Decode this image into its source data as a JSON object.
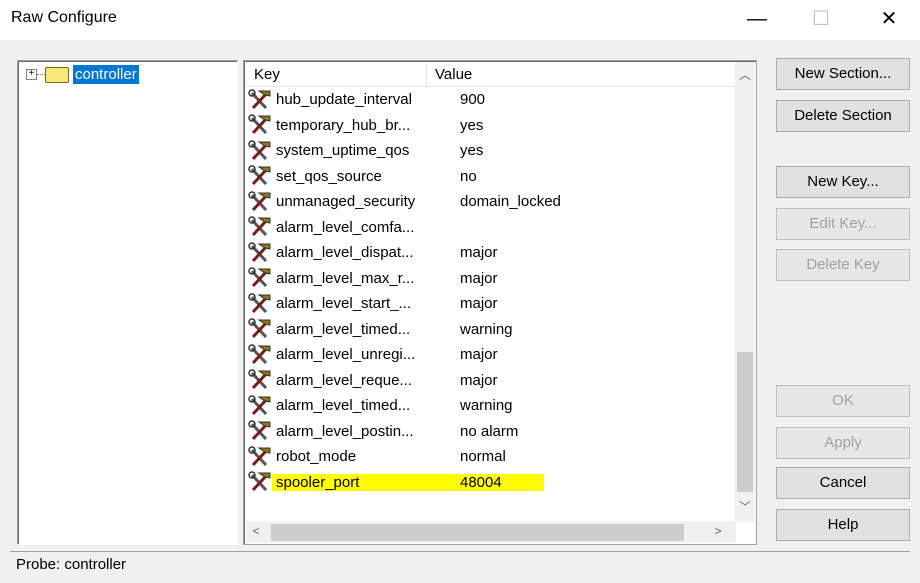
{
  "window": {
    "title": "Raw Configure",
    "minimize": "—",
    "maximize": "☐",
    "close": "✕"
  },
  "tree": {
    "root": {
      "label": "controller",
      "expander": "+"
    }
  },
  "list": {
    "columns": [
      "Key",
      "Value"
    ],
    "rows": [
      {
        "key": "hub_update_interval",
        "value": "900"
      },
      {
        "key": "temporary_hub_br...",
        "value": "yes"
      },
      {
        "key": "system_uptime_qos",
        "value": "yes"
      },
      {
        "key": "set_qos_source",
        "value": "no"
      },
      {
        "key": "unmanaged_security",
        "value": "domain_locked"
      },
      {
        "key": "alarm_level_comfa...",
        "value": ""
      },
      {
        "key": "alarm_level_dispat...",
        "value": "major"
      },
      {
        "key": "alarm_level_max_r...",
        "value": "major"
      },
      {
        "key": "alarm_level_start_...",
        "value": "major"
      },
      {
        "key": "alarm_level_timed...",
        "value": "warning"
      },
      {
        "key": "alarm_level_unregi...",
        "value": "major"
      },
      {
        "key": "alarm_level_reque...",
        "value": "major"
      },
      {
        "key": "alarm_level_timed...",
        "value": "warning"
      },
      {
        "key": "alarm_level_postin...",
        "value": "no alarm"
      },
      {
        "key": "robot_mode",
        "value": "normal"
      },
      {
        "key": "spooler_port",
        "value": "48004",
        "highlighted": true
      }
    ],
    "highlight_color": "#ffff00"
  },
  "buttons": {
    "new_section": "New Section...",
    "delete_section": "Delete Section",
    "new_key": "New Key...",
    "edit_key": "Edit Key...",
    "delete_key": "Delete Key",
    "ok": "OK",
    "apply": "Apply",
    "cancel": "Cancel",
    "help": "Help"
  },
  "status": "Probe: controller"
}
